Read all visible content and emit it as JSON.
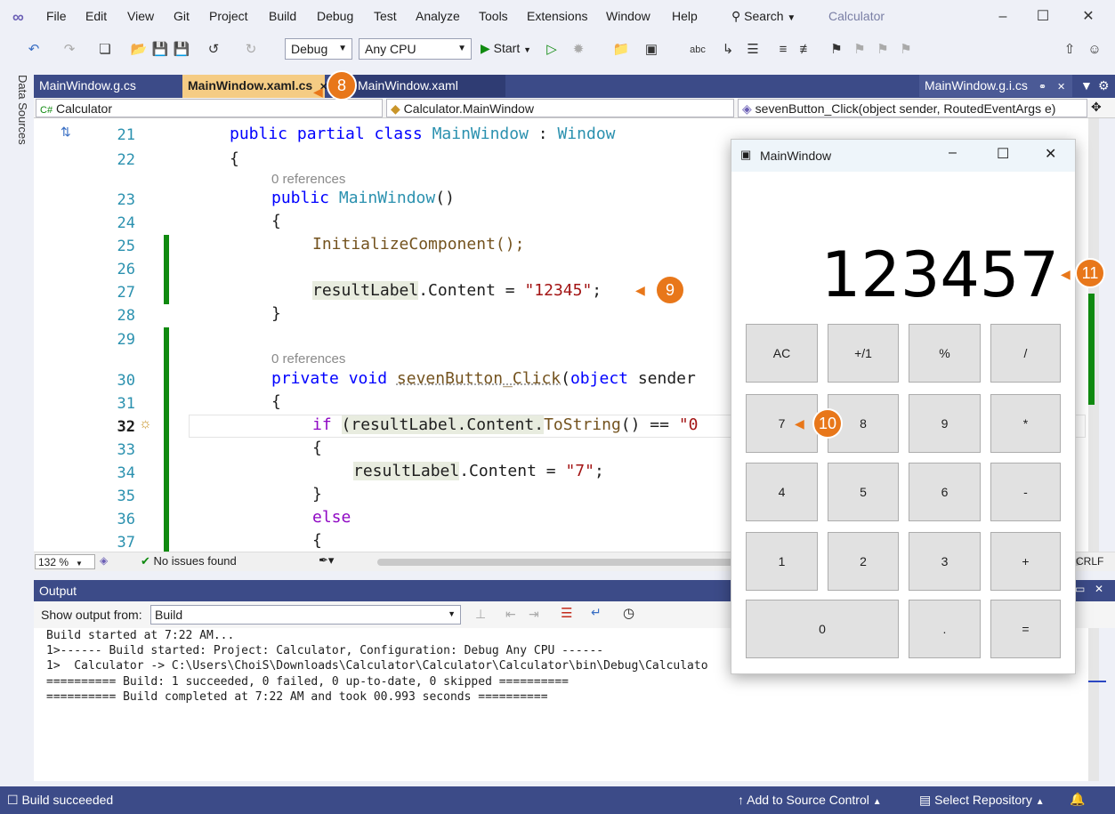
{
  "menubar": {
    "items": [
      "File",
      "Edit",
      "View",
      "Git",
      "Project",
      "Build",
      "Debug",
      "Test",
      "Analyze",
      "Tools",
      "Extensions",
      "Window",
      "Help"
    ],
    "search_label": "Search",
    "app_title": "Calculator"
  },
  "toolbar": {
    "config": "Debug",
    "platform": "Any CPU",
    "start_label": "Start"
  },
  "sidebar": {
    "data_sources": "Data Sources"
  },
  "tabs": [
    {
      "label": "MainWindow.g.cs"
    },
    {
      "label": "MainWindow.xaml.cs"
    },
    {
      "label": "MainWindow.xaml"
    },
    {
      "label": "MainWindow.g.i.cs"
    }
  ],
  "nav": {
    "project": "Calculator",
    "class": "Calculator.MainWindow",
    "member": "sevenButton_Click(object sender, RoutedEventArgs e)"
  },
  "code": {
    "line_numbers": [
      "21",
      "22",
      "23",
      "24",
      "25",
      "26",
      "27",
      "28",
      "29",
      "30",
      "31",
      "32",
      "33",
      "34",
      "35",
      "36",
      "37"
    ],
    "ref_0": "0 references",
    "ref_1": "0 references",
    "l21_a": "public partial class ",
    "l21_b": "MainWindow",
    "l21_c": " : ",
    "l21_d": "Window",
    "l22": "{",
    "l23_a": "public ",
    "l23_b": "MainWindow",
    "l23_c": "()",
    "l24": "{",
    "l25": "InitializeComponent();",
    "l27_a": "resultLabel",
    "l27_b": ".Content = ",
    "l27_c": "\"12345\"",
    "l27_d": ";",
    "l28": "}",
    "l30_a": "private void ",
    "l30_b": "sevenButton_Click",
    "l30_c": "(",
    "l30_d": "object",
    "l30_e": " sender",
    "l31": "{",
    "l32_a": "if ",
    "l32_b": "(resultLabel.Content.",
    "l32_c": "ToString",
    "l32_d": "() == ",
    "l32_e": "\"0",
    "l33": "{",
    "l34_a": "resultLabel",
    "l34_b": ".Content = ",
    "l34_c": "\"7\"",
    "l34_d": ";",
    "l35": "}",
    "l36": "else",
    "l37": "{"
  },
  "editor_status": {
    "zoom": "132 %",
    "issues": "No issues found",
    "crlf": "CRLF"
  },
  "output": {
    "title": "Output",
    "show_from_label": "Show output from:",
    "source": "Build",
    "lines": [
      "Build started at 7:22 AM...",
      "1>------ Build started: Project: Calculator, Configuration: Debug Any CPU ------",
      "1>  Calculator -> C:\\Users\\ChoiS\\Downloads\\Calculator\\Calculator\\Calculator\\bin\\Debug\\Calculato",
      "========== Build: 1 succeeded, 0 failed, 0 up-to-date, 0 skipped ==========",
      "========== Build completed at 7:22 AM and took 00.993 seconds =========="
    ]
  },
  "statusbar": {
    "left": "Build succeeded",
    "source_control": "Add to Source Control",
    "repository": "Select Repository"
  },
  "calc": {
    "title": "MainWindow",
    "display": "123457",
    "buttons": {
      "ac": "AC",
      "sign": "+/1",
      "pct": "%",
      "div": "/",
      "b7": "7",
      "b8": "8",
      "b9": "9",
      "mul": "*",
      "b4": "4",
      "b5": "5",
      "b6": "6",
      "sub": "-",
      "b1": "1",
      "b2": "2",
      "b3": "3",
      "add": "+",
      "b0": "0",
      "dot": ".",
      "eq": "="
    }
  },
  "callouts": {
    "c8": "8",
    "c9": "9",
    "c10": "10",
    "c11": "11"
  },
  "colors": {
    "accent": "#3c4b88",
    "tab_active": "#f5cc84",
    "callout": "#e8771a",
    "change_bar": "#108a10"
  }
}
